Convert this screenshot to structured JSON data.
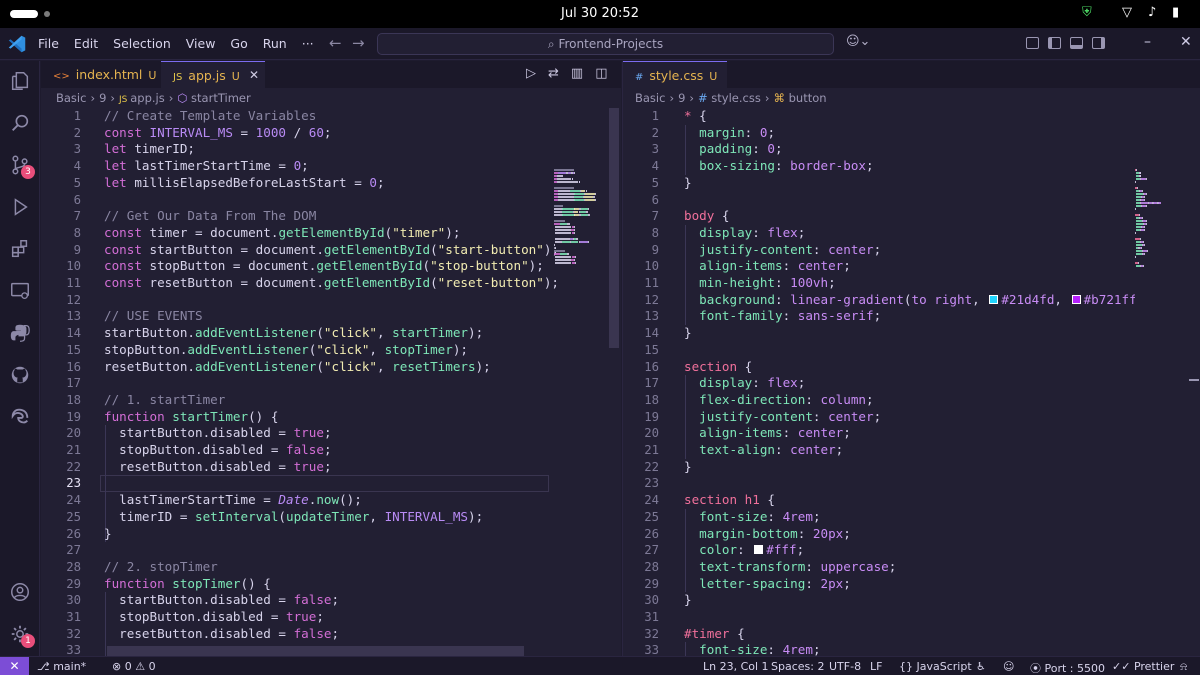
{
  "os": {
    "clock": "Jul 30  20:52"
  },
  "titlebar": {
    "menu": [
      "File",
      "Edit",
      "Selection",
      "View",
      "Go",
      "Run",
      "···"
    ],
    "search": "Frontend-Projects"
  },
  "activity_badges": {
    "source_control": "3",
    "settings": "1"
  },
  "left": {
    "tabs": [
      {
        "label": "index.html",
        "status": "U",
        "icon": "<>"
      },
      {
        "label": "app.js",
        "status": "U",
        "icon": "JS"
      }
    ],
    "breadcrumb": [
      "Basic",
      "9",
      "app.js",
      "startTimer"
    ],
    "lines": [
      [
        [
          "c",
          "// Create Template Variables"
        ]
      ],
      [
        [
          "k",
          "const "
        ],
        [
          "n",
          "INTERVAL_MS"
        ],
        [
          "p",
          " = "
        ],
        [
          "m",
          "1000"
        ],
        [
          "p",
          " / "
        ],
        [
          "m",
          "60"
        ],
        [
          "p",
          ";"
        ]
      ],
      [
        [
          "k",
          "let "
        ],
        [
          "v",
          "timerID"
        ],
        [
          "p",
          ";"
        ]
      ],
      [
        [
          "k",
          "let "
        ],
        [
          "v",
          "lastTimerStartTime"
        ],
        [
          "p",
          " = "
        ],
        [
          "m",
          "0"
        ],
        [
          "p",
          ";"
        ]
      ],
      [
        [
          "k",
          "let "
        ],
        [
          "v",
          "millisElapsedBeforeLastStart"
        ],
        [
          "p",
          " = "
        ],
        [
          "m",
          "0"
        ],
        [
          "p",
          ";"
        ]
      ],
      [],
      [
        [
          "c",
          "// Get Our Data From The DOM"
        ]
      ],
      [
        [
          "k",
          "const "
        ],
        [
          "v",
          "timer"
        ],
        [
          "p",
          " = "
        ],
        [
          "v",
          "document"
        ],
        [
          "p",
          "."
        ],
        [
          "f",
          "getElementById"
        ],
        [
          "p",
          "("
        ],
        [
          "s",
          "\"timer\""
        ],
        [
          "p",
          ");"
        ]
      ],
      [
        [
          "k",
          "const "
        ],
        [
          "v",
          "startButton"
        ],
        [
          "p",
          " = "
        ],
        [
          "v",
          "document"
        ],
        [
          "p",
          "."
        ],
        [
          "f",
          "getElementById"
        ],
        [
          "p",
          "("
        ],
        [
          "s",
          "\"start-button\""
        ],
        [
          "p",
          ");"
        ]
      ],
      [
        [
          "k",
          "const "
        ],
        [
          "v",
          "stopButton"
        ],
        [
          "p",
          " = "
        ],
        [
          "v",
          "document"
        ],
        [
          "p",
          "."
        ],
        [
          "f",
          "getElementById"
        ],
        [
          "p",
          "("
        ],
        [
          "s",
          "\"stop-button\""
        ],
        [
          "p",
          ");"
        ]
      ],
      [
        [
          "k",
          "const "
        ],
        [
          "v",
          "resetButton"
        ],
        [
          "p",
          " = "
        ],
        [
          "v",
          "document"
        ],
        [
          "p",
          "."
        ],
        [
          "f",
          "getElementById"
        ],
        [
          "p",
          "("
        ],
        [
          "s",
          "\"reset-button\""
        ],
        [
          "p",
          ");"
        ]
      ],
      [],
      [
        [
          "c",
          "// USE EVENTS"
        ]
      ],
      [
        [
          "v",
          "startButton"
        ],
        [
          "p",
          "."
        ],
        [
          "f",
          "addEventListener"
        ],
        [
          "p",
          "("
        ],
        [
          "s",
          "\"click\""
        ],
        [
          "p",
          ", "
        ],
        [
          "f",
          "startTimer"
        ],
        [
          "p",
          ");"
        ]
      ],
      [
        [
          "v",
          "stopButton"
        ],
        [
          "p",
          "."
        ],
        [
          "f",
          "addEventListener"
        ],
        [
          "p",
          "("
        ],
        [
          "s",
          "\"click\""
        ],
        [
          "p",
          ", "
        ],
        [
          "f",
          "stopTimer"
        ],
        [
          "p",
          ");"
        ]
      ],
      [
        [
          "v",
          "resetButton"
        ],
        [
          "p",
          "."
        ],
        [
          "f",
          "addEventListener"
        ],
        [
          "p",
          "("
        ],
        [
          "s",
          "\"click\""
        ],
        [
          "p",
          ", "
        ],
        [
          "f",
          "resetTimers"
        ],
        [
          "p",
          ");"
        ]
      ],
      [],
      [
        [
          "c",
          "// 1. startTimer"
        ]
      ],
      [
        [
          "k",
          "function "
        ],
        [
          "f",
          "startTimer"
        ],
        [
          "p",
          "() {"
        ]
      ],
      [
        [
          "p",
          "  "
        ],
        [
          "v",
          "startButton"
        ],
        [
          "p",
          "."
        ],
        [
          "v",
          "disabled"
        ],
        [
          "p",
          " = "
        ],
        [
          "b",
          "true"
        ],
        [
          "p",
          ";"
        ]
      ],
      [
        [
          "p",
          "  "
        ],
        [
          "v",
          "stopButton"
        ],
        [
          "p",
          "."
        ],
        [
          "v",
          "disabled"
        ],
        [
          "p",
          " = "
        ],
        [
          "b",
          "false"
        ],
        [
          "p",
          ";"
        ]
      ],
      [
        [
          "p",
          "  "
        ],
        [
          "v",
          "resetButton"
        ],
        [
          "p",
          "."
        ],
        [
          "v",
          "disabled"
        ],
        [
          "p",
          " = "
        ],
        [
          "b",
          "true"
        ],
        [
          "p",
          ";"
        ]
      ],
      [],
      [
        [
          "p",
          "  "
        ],
        [
          "v",
          "lastTimerStartTime"
        ],
        [
          "p",
          " = "
        ],
        [
          "t",
          "Date"
        ],
        [
          "p",
          "."
        ],
        [
          "f",
          "now"
        ],
        [
          "p",
          "();"
        ]
      ],
      [
        [
          "p",
          "  "
        ],
        [
          "v",
          "timerID"
        ],
        [
          "p",
          " = "
        ],
        [
          "f",
          "setInterval"
        ],
        [
          "p",
          "("
        ],
        [
          "f",
          "updateTimer"
        ],
        [
          "p",
          ", "
        ],
        [
          "n",
          "INTERVAL_MS"
        ],
        [
          "p",
          ");"
        ]
      ],
      [
        [
          "p",
          "}"
        ]
      ],
      [],
      [
        [
          "c",
          "// 2. stopTimer"
        ]
      ],
      [
        [
          "k",
          "function "
        ],
        [
          "f",
          "stopTimer"
        ],
        [
          "p",
          "() {"
        ]
      ],
      [
        [
          "p",
          "  "
        ],
        [
          "v",
          "startButton"
        ],
        [
          "p",
          "."
        ],
        [
          "v",
          "disabled"
        ],
        [
          "p",
          " = "
        ],
        [
          "b",
          "false"
        ],
        [
          "p",
          ";"
        ]
      ],
      [
        [
          "p",
          "  "
        ],
        [
          "v",
          "stopButton"
        ],
        [
          "p",
          "."
        ],
        [
          "v",
          "disabled"
        ],
        [
          "p",
          " = "
        ],
        [
          "b",
          "true"
        ],
        [
          "p",
          ";"
        ]
      ],
      [
        [
          "p",
          "  "
        ],
        [
          "v",
          "resetButton"
        ],
        [
          "p",
          "."
        ],
        [
          "v",
          "disabled"
        ],
        [
          "p",
          " = "
        ],
        [
          "b",
          "false"
        ],
        [
          "p",
          ";"
        ]
      ],
      []
    ]
  },
  "right": {
    "tabs": [
      {
        "label": "style.css",
        "status": "U",
        "icon": "#"
      }
    ],
    "breadcrumb": [
      "Basic",
      "9",
      "style.css",
      "button"
    ],
    "lines": [
      [
        [
          "sel",
          "* "
        ],
        [
          "p",
          "{"
        ]
      ],
      [
        [
          "p",
          "  "
        ],
        [
          "pr",
          "margin"
        ],
        [
          "p",
          ": "
        ],
        [
          "val",
          "0"
        ],
        [
          "p",
          ";"
        ]
      ],
      [
        [
          "p",
          "  "
        ],
        [
          "pr",
          "padding"
        ],
        [
          "p",
          ": "
        ],
        [
          "val",
          "0"
        ],
        [
          "p",
          ";"
        ]
      ],
      [
        [
          "p",
          "  "
        ],
        [
          "pr",
          "box-sizing"
        ],
        [
          "p",
          ": "
        ],
        [
          "val",
          "border-box"
        ],
        [
          "p",
          ";"
        ]
      ],
      [
        [
          "p",
          "}"
        ]
      ],
      [],
      [
        [
          "sel",
          "body "
        ],
        [
          "p",
          "{"
        ]
      ],
      [
        [
          "p",
          "  "
        ],
        [
          "pr",
          "display"
        ],
        [
          "p",
          ": "
        ],
        [
          "val",
          "flex"
        ],
        [
          "p",
          ";"
        ]
      ],
      [
        [
          "p",
          "  "
        ],
        [
          "pr",
          "justify-content"
        ],
        [
          "p",
          ": "
        ],
        [
          "val",
          "center"
        ],
        [
          "p",
          ";"
        ]
      ],
      [
        [
          "p",
          "  "
        ],
        [
          "pr",
          "align-items"
        ],
        [
          "p",
          ": "
        ],
        [
          "val",
          "center"
        ],
        [
          "p",
          ";"
        ]
      ],
      [
        [
          "p",
          "  "
        ],
        [
          "pr",
          "min-height"
        ],
        [
          "p",
          ": "
        ],
        [
          "val",
          "100vh"
        ],
        [
          "p",
          ";"
        ]
      ],
      [
        [
          "p",
          "  "
        ],
        [
          "pr",
          "background"
        ],
        [
          "p",
          ": "
        ],
        [
          "val",
          "linear-gradient"
        ],
        [
          "p",
          "("
        ],
        [
          "val",
          "to right"
        ],
        [
          "p",
          ", "
        ],
        [
          "sw",
          "#21d4fd"
        ],
        [
          "val",
          "#21d4fd"
        ],
        [
          "p",
          ", "
        ],
        [
          "sw",
          "#b721ff"
        ],
        [
          "val",
          "#b721ff"
        ]
      ],
      [
        [
          "p",
          "  "
        ],
        [
          "pr",
          "font-family"
        ],
        [
          "p",
          ": "
        ],
        [
          "val",
          "sans-serif"
        ],
        [
          "p",
          ";"
        ]
      ],
      [
        [
          "p",
          "}"
        ]
      ],
      [],
      [
        [
          "sel",
          "section "
        ],
        [
          "p",
          "{"
        ]
      ],
      [
        [
          "p",
          "  "
        ],
        [
          "pr",
          "display"
        ],
        [
          "p",
          ": "
        ],
        [
          "val",
          "flex"
        ],
        [
          "p",
          ";"
        ]
      ],
      [
        [
          "p",
          "  "
        ],
        [
          "pr",
          "flex-direction"
        ],
        [
          "p",
          ": "
        ],
        [
          "val",
          "column"
        ],
        [
          "p",
          ";"
        ]
      ],
      [
        [
          "p",
          "  "
        ],
        [
          "pr",
          "justify-content"
        ],
        [
          "p",
          ": "
        ],
        [
          "val",
          "center"
        ],
        [
          "p",
          ";"
        ]
      ],
      [
        [
          "p",
          "  "
        ],
        [
          "pr",
          "align-items"
        ],
        [
          "p",
          ": "
        ],
        [
          "val",
          "center"
        ],
        [
          "p",
          ";"
        ]
      ],
      [
        [
          "p",
          "  "
        ],
        [
          "pr",
          "text-align"
        ],
        [
          "p",
          ": "
        ],
        [
          "val",
          "center"
        ],
        [
          "p",
          ";"
        ]
      ],
      [
        [
          "p",
          "}"
        ]
      ],
      [],
      [
        [
          "sel",
          "section h1 "
        ],
        [
          "p",
          "{"
        ]
      ],
      [
        [
          "p",
          "  "
        ],
        [
          "pr",
          "font-size"
        ],
        [
          "p",
          ": "
        ],
        [
          "val",
          "4rem"
        ],
        [
          "p",
          ";"
        ]
      ],
      [
        [
          "p",
          "  "
        ],
        [
          "pr",
          "margin-bottom"
        ],
        [
          "p",
          ": "
        ],
        [
          "val",
          "20px"
        ],
        [
          "p",
          ";"
        ]
      ],
      [
        [
          "p",
          "  "
        ],
        [
          "pr",
          "color"
        ],
        [
          "p",
          ": "
        ],
        [
          "sw",
          "#ffffff"
        ],
        [
          "val",
          "#fff"
        ],
        [
          "p",
          ";"
        ]
      ],
      [
        [
          "p",
          "  "
        ],
        [
          "pr",
          "text-transform"
        ],
        [
          "p",
          ": "
        ],
        [
          "val",
          "uppercase"
        ],
        [
          "p",
          ";"
        ]
      ],
      [
        [
          "p",
          "  "
        ],
        [
          "pr",
          "letter-spacing"
        ],
        [
          "p",
          ": "
        ],
        [
          "val",
          "2px"
        ],
        [
          "p",
          ";"
        ]
      ],
      [
        [
          "p",
          "}"
        ]
      ],
      [],
      [
        [
          "sel",
          "#timer "
        ],
        [
          "p",
          "{"
        ]
      ],
      [
        [
          "p",
          "  "
        ],
        [
          "pr",
          "font-size"
        ],
        [
          "p",
          ": "
        ],
        [
          "val",
          "4rem"
        ],
        [
          "p",
          ";"
        ]
      ]
    ]
  },
  "status": {
    "branch": "main*",
    "errors": "0",
    "warnings": "0",
    "position": "Ln 23, Col 1",
    "spaces": "Spaces: 2",
    "encoding": "UTF-8",
    "eol": "LF",
    "language": "JavaScript",
    "port": "Port : 5500",
    "prettier": "Prettier"
  },
  "colors": {
    "accent": "#7c4dd6",
    "background": "#221f33",
    "sidebar": "#1b1829",
    "badge": "#e94e7b",
    "modified": "#e6b450"
  }
}
